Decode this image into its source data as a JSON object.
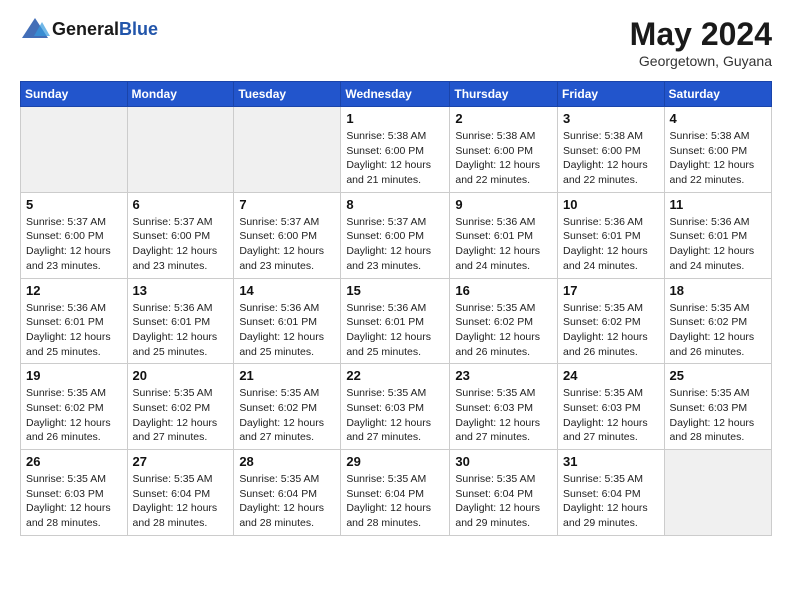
{
  "logo": {
    "general": "General",
    "blue": "Blue"
  },
  "title": "May 2024",
  "subtitle": "Georgetown, Guyana",
  "weekdays": [
    "Sunday",
    "Monday",
    "Tuesday",
    "Wednesday",
    "Thursday",
    "Friday",
    "Saturday"
  ],
  "weeks": [
    [
      {
        "day": "",
        "info": ""
      },
      {
        "day": "",
        "info": ""
      },
      {
        "day": "",
        "info": ""
      },
      {
        "day": "1",
        "info": "Sunrise: 5:38 AM\nSunset: 6:00 PM\nDaylight: 12 hours\nand 21 minutes."
      },
      {
        "day": "2",
        "info": "Sunrise: 5:38 AM\nSunset: 6:00 PM\nDaylight: 12 hours\nand 22 minutes."
      },
      {
        "day": "3",
        "info": "Sunrise: 5:38 AM\nSunset: 6:00 PM\nDaylight: 12 hours\nand 22 minutes."
      },
      {
        "day": "4",
        "info": "Sunrise: 5:38 AM\nSunset: 6:00 PM\nDaylight: 12 hours\nand 22 minutes."
      }
    ],
    [
      {
        "day": "5",
        "info": "Sunrise: 5:37 AM\nSunset: 6:00 PM\nDaylight: 12 hours\nand 23 minutes."
      },
      {
        "day": "6",
        "info": "Sunrise: 5:37 AM\nSunset: 6:00 PM\nDaylight: 12 hours\nand 23 minutes."
      },
      {
        "day": "7",
        "info": "Sunrise: 5:37 AM\nSunset: 6:00 PM\nDaylight: 12 hours\nand 23 minutes."
      },
      {
        "day": "8",
        "info": "Sunrise: 5:37 AM\nSunset: 6:00 PM\nDaylight: 12 hours\nand 23 minutes."
      },
      {
        "day": "9",
        "info": "Sunrise: 5:36 AM\nSunset: 6:01 PM\nDaylight: 12 hours\nand 24 minutes."
      },
      {
        "day": "10",
        "info": "Sunrise: 5:36 AM\nSunset: 6:01 PM\nDaylight: 12 hours\nand 24 minutes."
      },
      {
        "day": "11",
        "info": "Sunrise: 5:36 AM\nSunset: 6:01 PM\nDaylight: 12 hours\nand 24 minutes."
      }
    ],
    [
      {
        "day": "12",
        "info": "Sunrise: 5:36 AM\nSunset: 6:01 PM\nDaylight: 12 hours\nand 25 minutes."
      },
      {
        "day": "13",
        "info": "Sunrise: 5:36 AM\nSunset: 6:01 PM\nDaylight: 12 hours\nand 25 minutes."
      },
      {
        "day": "14",
        "info": "Sunrise: 5:36 AM\nSunset: 6:01 PM\nDaylight: 12 hours\nand 25 minutes."
      },
      {
        "day": "15",
        "info": "Sunrise: 5:36 AM\nSunset: 6:01 PM\nDaylight: 12 hours\nand 25 minutes."
      },
      {
        "day": "16",
        "info": "Sunrise: 5:35 AM\nSunset: 6:02 PM\nDaylight: 12 hours\nand 26 minutes."
      },
      {
        "day": "17",
        "info": "Sunrise: 5:35 AM\nSunset: 6:02 PM\nDaylight: 12 hours\nand 26 minutes."
      },
      {
        "day": "18",
        "info": "Sunrise: 5:35 AM\nSunset: 6:02 PM\nDaylight: 12 hours\nand 26 minutes."
      }
    ],
    [
      {
        "day": "19",
        "info": "Sunrise: 5:35 AM\nSunset: 6:02 PM\nDaylight: 12 hours\nand 26 minutes."
      },
      {
        "day": "20",
        "info": "Sunrise: 5:35 AM\nSunset: 6:02 PM\nDaylight: 12 hours\nand 27 minutes."
      },
      {
        "day": "21",
        "info": "Sunrise: 5:35 AM\nSunset: 6:02 PM\nDaylight: 12 hours\nand 27 minutes."
      },
      {
        "day": "22",
        "info": "Sunrise: 5:35 AM\nSunset: 6:03 PM\nDaylight: 12 hours\nand 27 minutes."
      },
      {
        "day": "23",
        "info": "Sunrise: 5:35 AM\nSunset: 6:03 PM\nDaylight: 12 hours\nand 27 minutes."
      },
      {
        "day": "24",
        "info": "Sunrise: 5:35 AM\nSunset: 6:03 PM\nDaylight: 12 hours\nand 27 minutes."
      },
      {
        "day": "25",
        "info": "Sunrise: 5:35 AM\nSunset: 6:03 PM\nDaylight: 12 hours\nand 28 minutes."
      }
    ],
    [
      {
        "day": "26",
        "info": "Sunrise: 5:35 AM\nSunset: 6:03 PM\nDaylight: 12 hours\nand 28 minutes."
      },
      {
        "day": "27",
        "info": "Sunrise: 5:35 AM\nSunset: 6:04 PM\nDaylight: 12 hours\nand 28 minutes."
      },
      {
        "day": "28",
        "info": "Sunrise: 5:35 AM\nSunset: 6:04 PM\nDaylight: 12 hours\nand 28 minutes."
      },
      {
        "day": "29",
        "info": "Sunrise: 5:35 AM\nSunset: 6:04 PM\nDaylight: 12 hours\nand 28 minutes."
      },
      {
        "day": "30",
        "info": "Sunrise: 5:35 AM\nSunset: 6:04 PM\nDaylight: 12 hours\nand 29 minutes."
      },
      {
        "day": "31",
        "info": "Sunrise: 5:35 AM\nSunset: 6:04 PM\nDaylight: 12 hours\nand 29 minutes."
      },
      {
        "day": "",
        "info": ""
      }
    ]
  ]
}
